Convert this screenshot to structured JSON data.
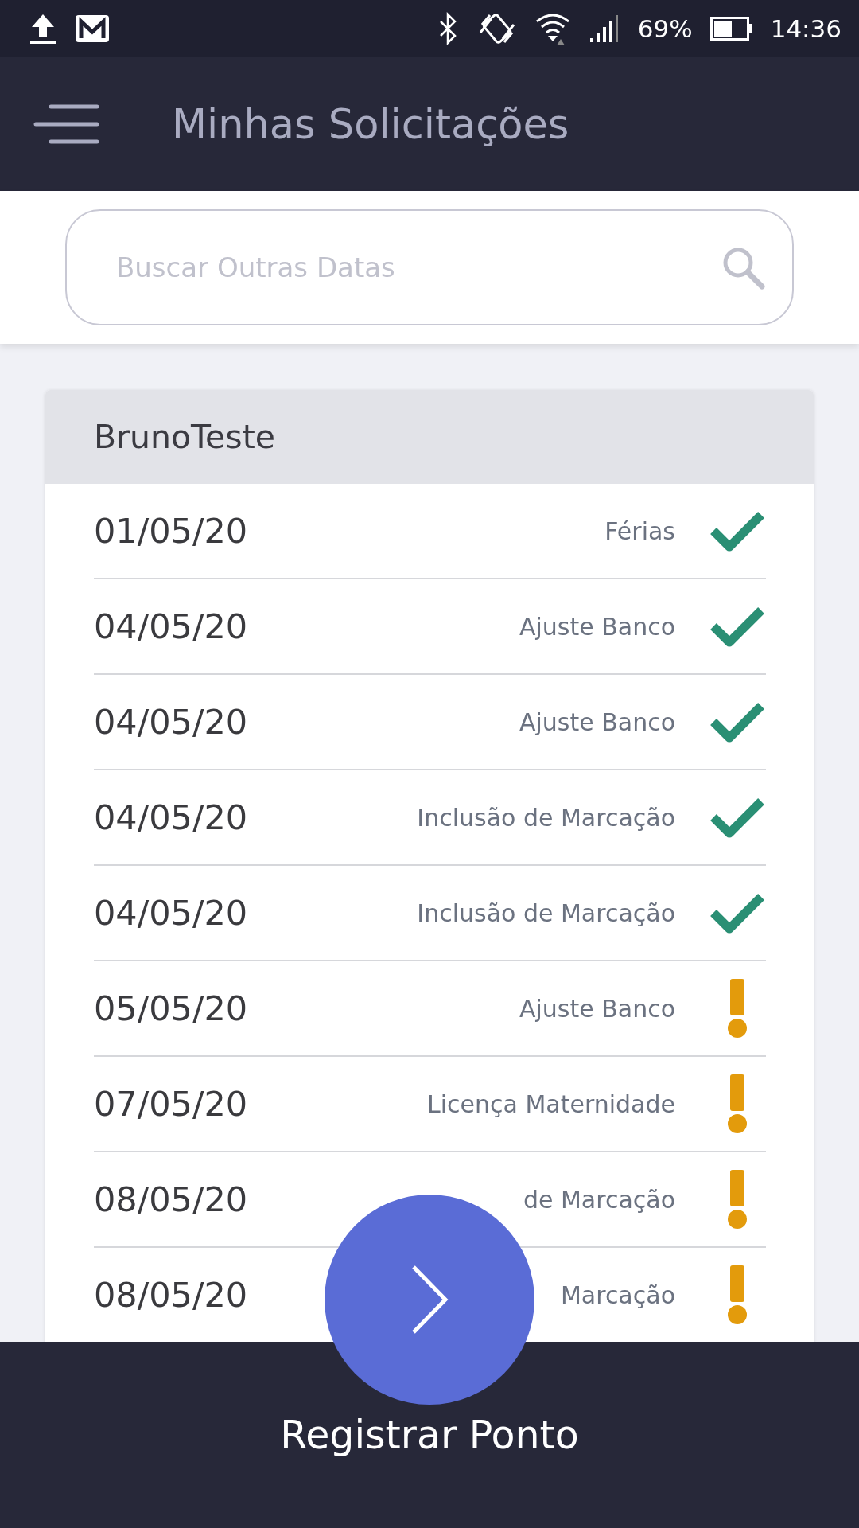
{
  "status_bar": {
    "battery": "69%",
    "time": "14:36"
  },
  "header": {
    "title": "Minhas Solicitações"
  },
  "search": {
    "placeholder": "Buscar Outras Datas"
  },
  "card": {
    "title": "BrunoTeste",
    "rows": [
      {
        "date": "01/05/20",
        "type": "Férias",
        "kind": "approved"
      },
      {
        "date": "04/05/20",
        "type": "Ajuste Banco",
        "kind": "approved"
      },
      {
        "date": "04/05/20",
        "type": "Ajuste Banco",
        "kind": "approved"
      },
      {
        "date": "04/05/20",
        "type": "Inclusão de Marcação",
        "kind": "approved"
      },
      {
        "date": "04/05/20",
        "type": "Inclusão de Marcação",
        "kind": "approved"
      },
      {
        "date": "05/05/20",
        "type": "Ajuste Banco",
        "kind": "pending"
      },
      {
        "date": "07/05/20",
        "type": "Licença Maternidade",
        "kind": "pending"
      },
      {
        "date": "08/05/20",
        "type": "de Marcação",
        "kind": "pending"
      },
      {
        "date": "08/05/20",
        "type": "Marcação",
        "kind": "pending"
      }
    ]
  },
  "bottom_bar": {
    "label": "Registrar Ponto"
  }
}
